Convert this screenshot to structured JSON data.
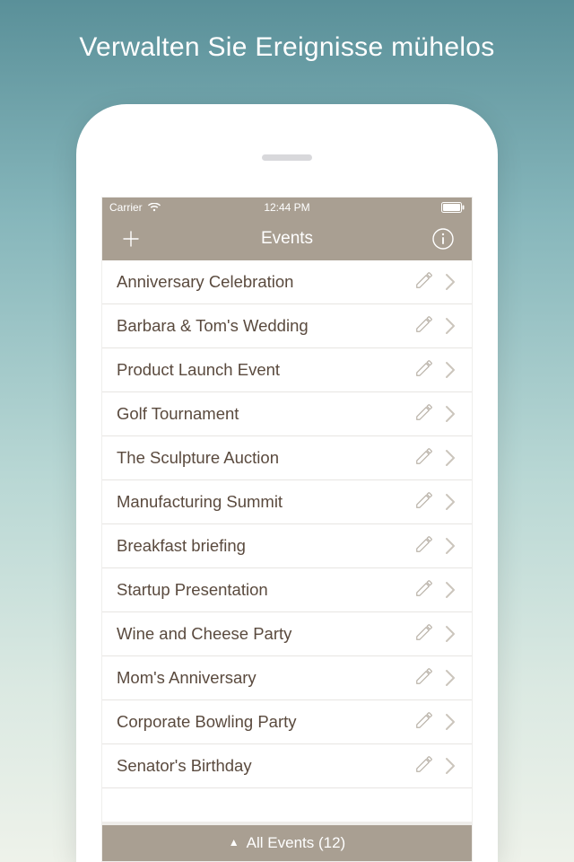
{
  "promo": {
    "title": "Verwalten Sie Ereignisse mühelos"
  },
  "status": {
    "carrier": "Carrier",
    "time": "12:44 PM"
  },
  "nav": {
    "title": "Events"
  },
  "events": [
    {
      "label": "Anniversary Celebration"
    },
    {
      "label": "Barbara & Tom's Wedding"
    },
    {
      "label": "Product Launch Event"
    },
    {
      "label": "Golf Tournament"
    },
    {
      "label": "The Sculpture Auction"
    },
    {
      "label": "Manufacturing Summit"
    },
    {
      "label": "Breakfast briefing"
    },
    {
      "label": "Startup Presentation"
    },
    {
      "label": "Wine and Cheese Party"
    },
    {
      "label": "Mom's Anniversary"
    },
    {
      "label": "Corporate Bowling Party"
    },
    {
      "label": "Senator's Birthday"
    }
  ],
  "footer": {
    "triangle": "▲",
    "label": "All Events (12)"
  },
  "colors": {
    "accent": "#a99f92",
    "text": "#5a4a3e"
  }
}
